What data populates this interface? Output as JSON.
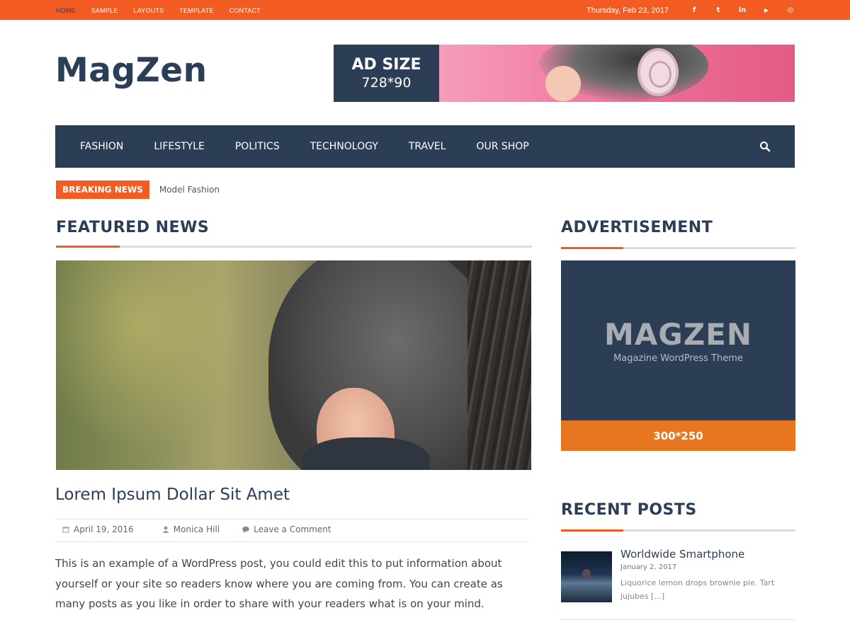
{
  "topbar": {
    "nav": [
      "HOME",
      "SAMPLE",
      "LAYOUTS",
      "TEMPLATE",
      "CONTACT"
    ],
    "date": "Thursday, Feb 23, 2017",
    "social_icons": [
      "facebook-icon",
      "twitter-icon",
      "linkedin-icon",
      "youtube-icon",
      "instagram-icon"
    ],
    "social_glyphs": [
      "f",
      "t",
      "in",
      "▶",
      "◎"
    ]
  },
  "header": {
    "logo": "MagZen",
    "ad": {
      "title": "AD SIZE",
      "size": "728*90"
    }
  },
  "mainnav": {
    "items": [
      "FASHION",
      "LIFESTYLE",
      "POLITICS",
      "TECHNOLOGY",
      "TRAVEL",
      "OUR SHOP"
    ]
  },
  "breaking": {
    "label": "BREAKING NEWS",
    "headline": "Model Fashion"
  },
  "featured": {
    "heading": "FEATURED NEWS",
    "post": {
      "title": "Lorem Ipsum Dollar Sit Amet",
      "date": "April 19, 2016",
      "author": "Monica Hill",
      "comments": "Leave a Comment",
      "excerpt": "This is an example of a WordPress post, you could edit this to put information about yourself or your site so readers know where you are coming from. You can create as many posts as you like in order to share with your readers what is on your mind."
    }
  },
  "sidebar": {
    "ad_heading": "ADVERTISEMENT",
    "ad": {
      "brand": "MAGZEN",
      "tagline": "Magazine WordPress Theme",
      "size": "300*250"
    },
    "recent_heading": "RECENT POSTS",
    "recent": [
      {
        "title": "Worldwide Smartphone",
        "date": "January 2, 2017",
        "excerpt": "Liquorice lemon drops brownie pie. Tart jujubes [...]"
      }
    ]
  },
  "colors": {
    "accent": "#f25c22",
    "navy": "#2c3e56",
    "ad_orange": "#e8751f"
  }
}
